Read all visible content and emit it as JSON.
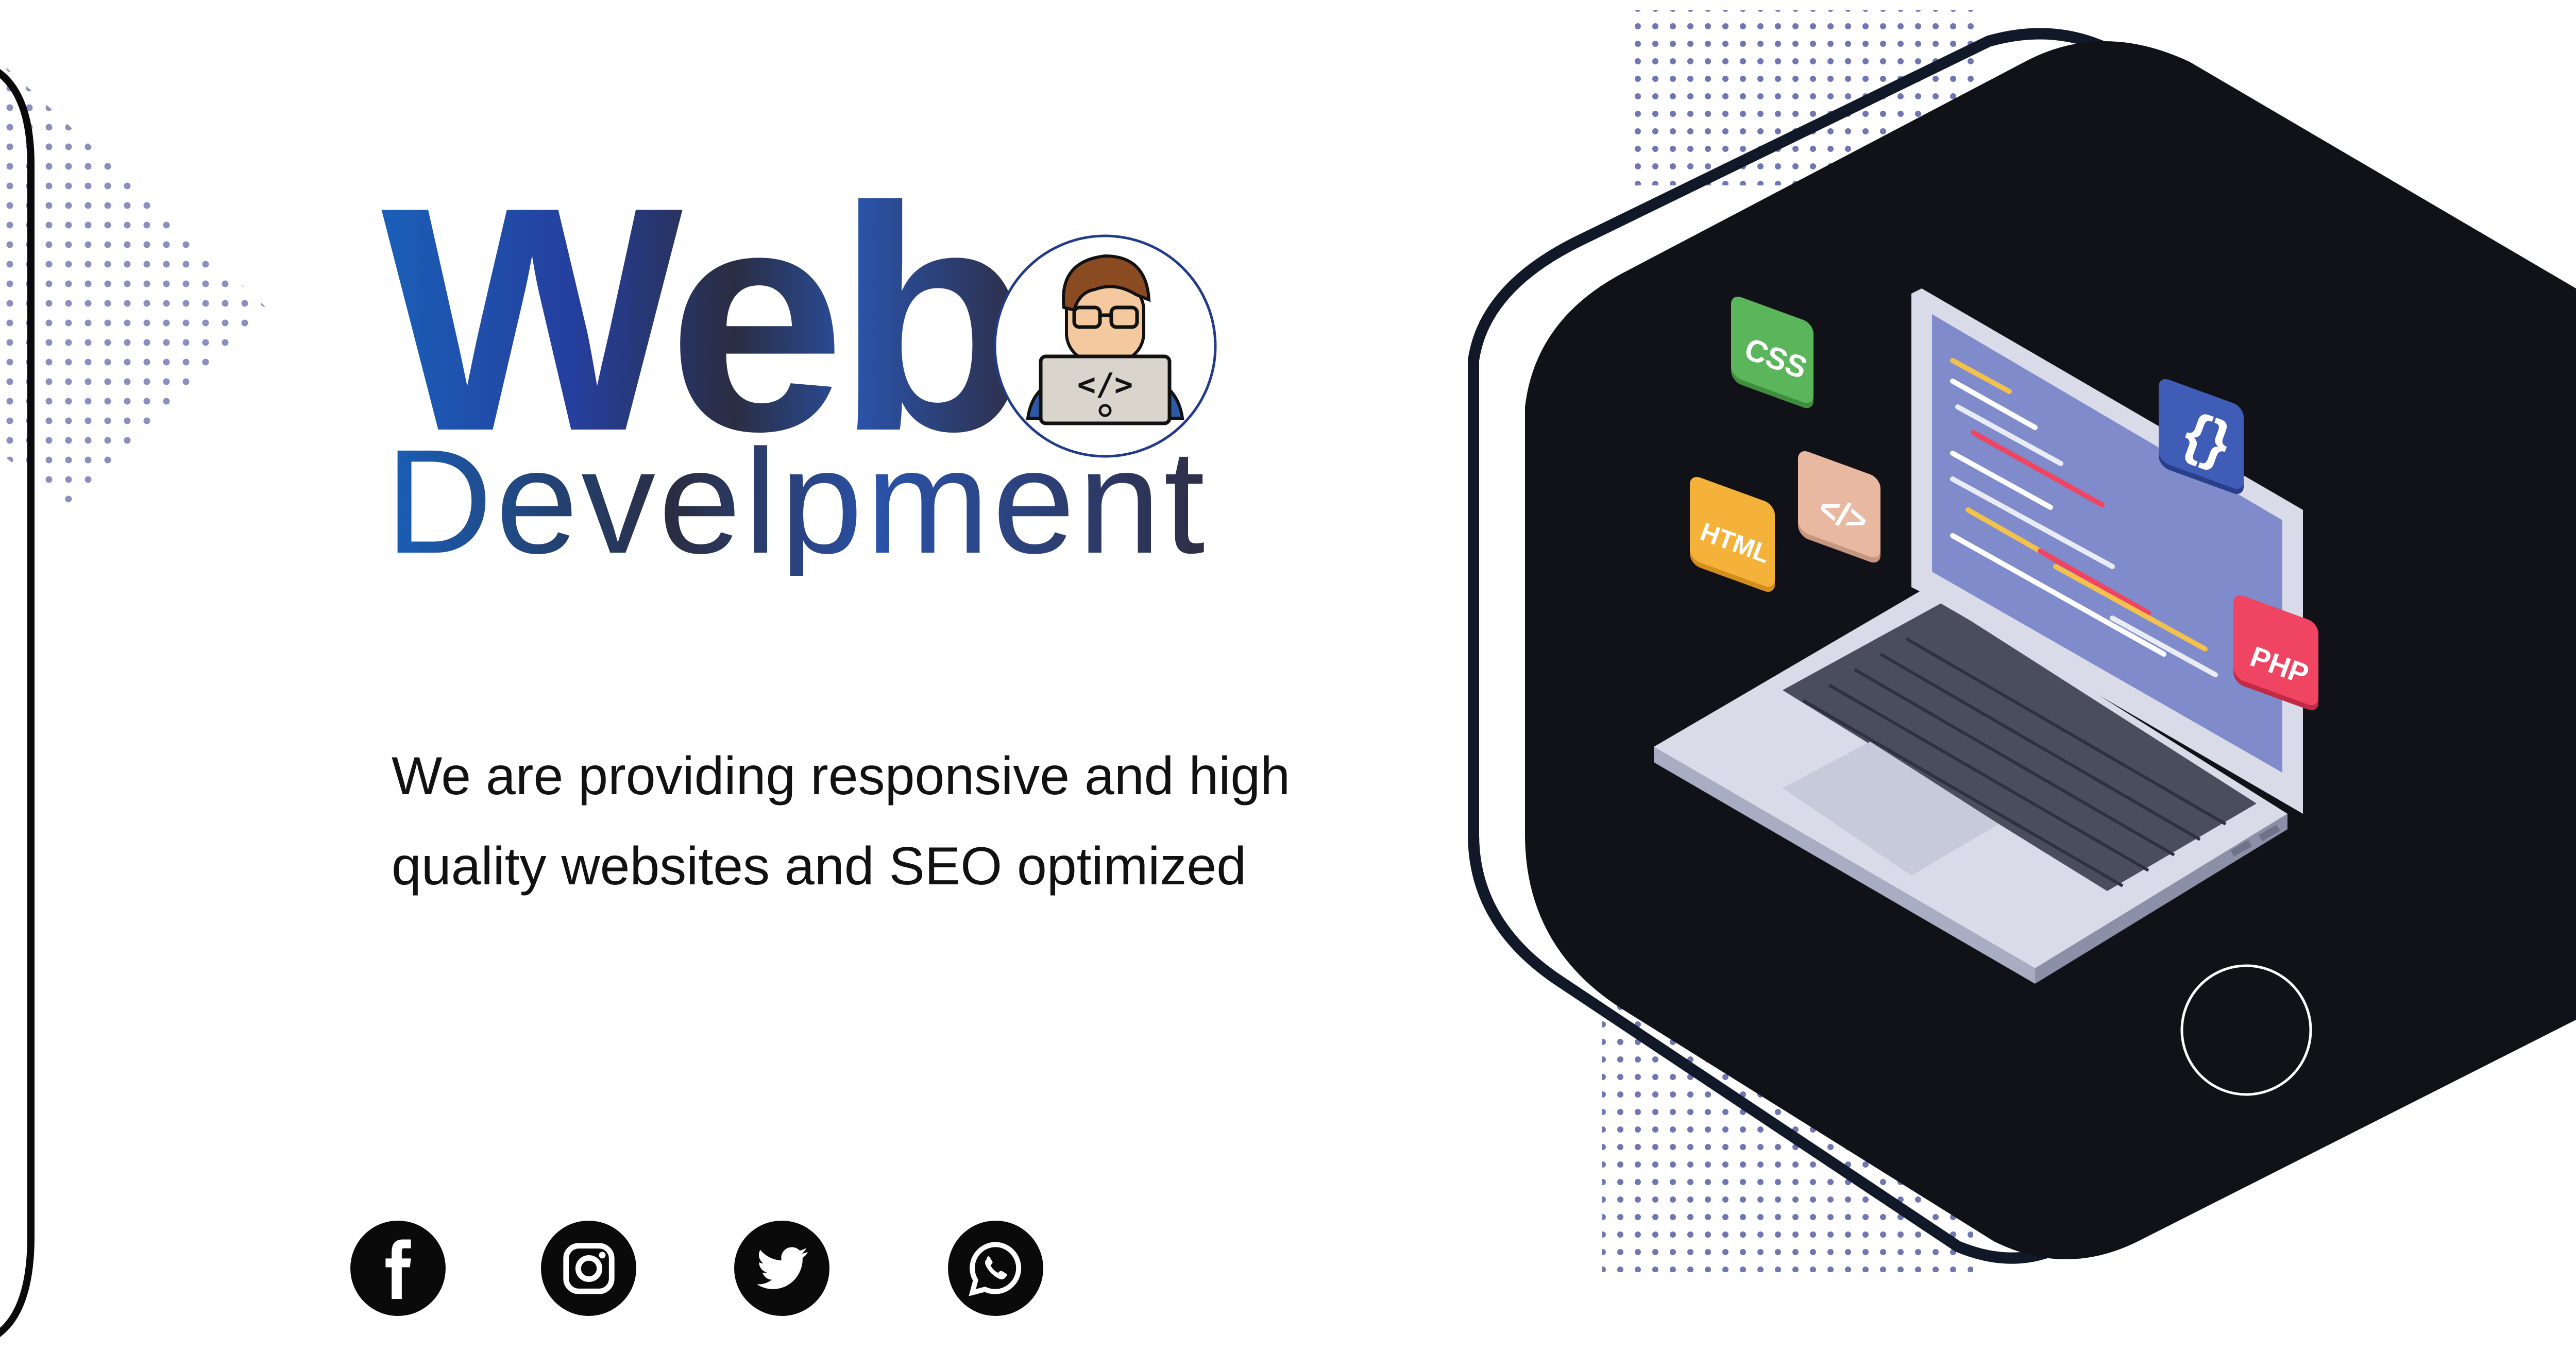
{
  "hero": {
    "title": "Web",
    "subtitle": "Develpment",
    "tagline": "We are providing responsive and high quality websites and SEO optimized"
  },
  "tech_tiles": [
    {
      "label": "CSS",
      "color": "#5bb55a"
    },
    {
      "label": "</>",
      "color": "#e8b8a0"
    },
    {
      "label": "HTML",
      "color": "#f5b23a"
    },
    {
      "label": "{}",
      "color": "#3f5cb6"
    },
    {
      "label": "PHP",
      "color": "#ef4563"
    }
  ],
  "social_links": [
    {
      "name": "Facebook",
      "icon": "facebook-icon"
    },
    {
      "name": "Instagram",
      "icon": "instagram-icon"
    },
    {
      "name": "Twitter",
      "icon": "twitter-icon"
    },
    {
      "name": "WhatsApp",
      "icon": "whatsapp-icon"
    }
  ],
  "colors": {
    "brand_blue": "#1a5fb8",
    "brand_dark": "#2a2d42",
    "hexagon": "#111118",
    "dots": "#8a8fc0",
    "screen": "#7f8bcb"
  }
}
